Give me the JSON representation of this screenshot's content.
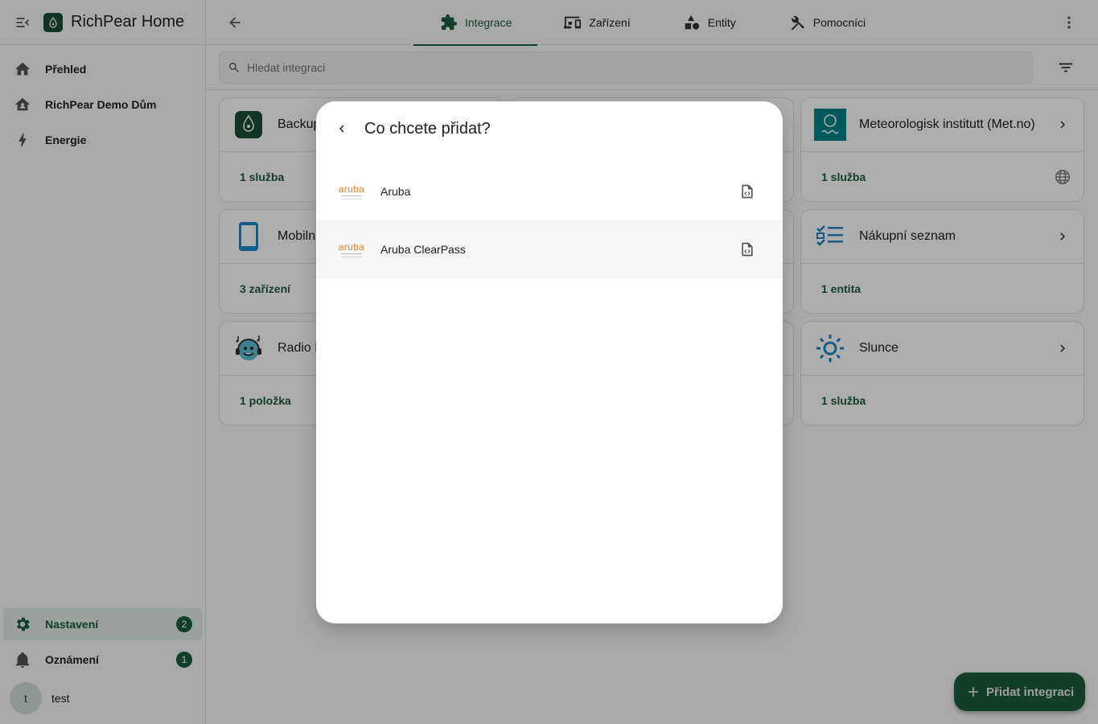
{
  "app": {
    "title": "RichPear Home"
  },
  "sidebar": {
    "items": [
      {
        "label": "Přehled",
        "icon": "home-icon"
      },
      {
        "label": "RichPear Demo Dům",
        "icon": "home-account-icon"
      },
      {
        "label": "Energie",
        "icon": "lightning-icon"
      }
    ],
    "bottom": [
      {
        "label": "Nastavení",
        "icon": "gear-icon",
        "badge": "2",
        "active": true
      },
      {
        "label": "Oznámení",
        "icon": "bell-icon",
        "badge": "1"
      }
    ],
    "user": {
      "initial": "t",
      "name": "test"
    }
  },
  "tabs": [
    {
      "label": "Integrace",
      "icon": "puzzle-icon",
      "active": true
    },
    {
      "label": "Zařízení",
      "icon": "devices-icon"
    },
    {
      "label": "Entity",
      "icon": "shapes-icon"
    },
    {
      "label": "Pomocníci",
      "icon": "tools-icon"
    }
  ],
  "search": {
    "placeholder": "Hledat integraci",
    "value": ""
  },
  "cards": [
    {
      "title": "Backup",
      "link": "1 služba"
    },
    {
      "title": "Meteorologisk institutt (Met.no)",
      "link": "1 služba"
    },
    {
      "title": "Mobilní aplikace",
      "link": "3 zařízení"
    },
    {
      "title": "Nákupní seznam",
      "link": "1 entita"
    },
    {
      "title": "Radio Browser",
      "link": "1 položka"
    },
    {
      "title": "Slunce",
      "link": "1 služba"
    }
  ],
  "dialog": {
    "title": "Co chcete přidat?",
    "items": [
      {
        "label": "Aruba",
        "logo_text": "aruba"
      },
      {
        "label": "Aruba ClearPass",
        "logo_text": "aruba"
      }
    ]
  },
  "fab": {
    "label": "Přidat integraci"
  },
  "colors": {
    "primary": "#1b5e3b",
    "logo_orange": "#f08020",
    "metno_teal": "#00858a"
  }
}
